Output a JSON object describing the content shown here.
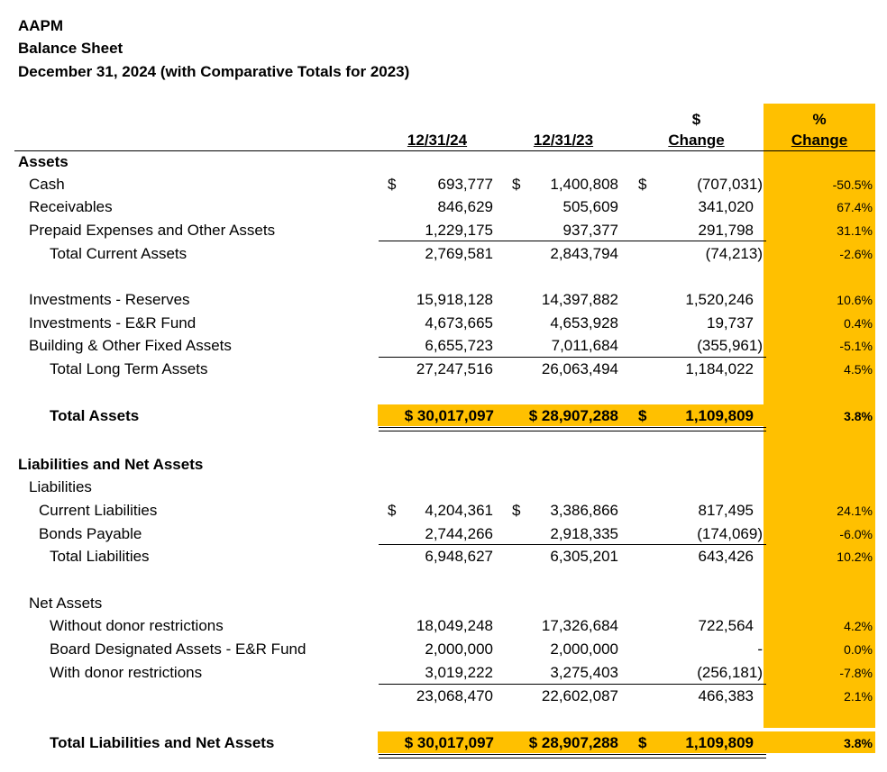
{
  "header": {
    "org": "AAPM",
    "title": "Balance Sheet",
    "period": "December 31, 2024 (with Comparative Totals for 2023)"
  },
  "columns": {
    "c2024": "12/31/24",
    "c2023": "12/31/23",
    "dollar_top": "$",
    "dollar_bottom": "Change",
    "pct_top": "%",
    "pct_bottom": "Change"
  },
  "highlight_color": "#FFC000",
  "rows": [
    {
      "label": "Assets",
      "bold": true
    },
    {
      "label": "Cash",
      "c2024": "693,777",
      "c2023": "1,400,808",
      "chg": "(707,031)",
      "pct": "-50.5%",
      "cur2024": "$",
      "cur2023": "$",
      "curChg": "$"
    },
    {
      "label": "Receivables",
      "c2024": "846,629",
      "c2023": "505,609",
      "chg": "341,020",
      "pct": "67.4%"
    },
    {
      "label": "Prepaid Expenses and Other Assets",
      "c2024": "1,229,175",
      "c2023": "937,377",
      "chg": "291,798",
      "pct": "31.1%"
    },
    {
      "label": "Total Current Assets",
      "c2024": "2,769,581",
      "c2023": "2,843,794",
      "chg": "(74,213)",
      "pct": "-2.6%"
    },
    {
      "label": "Investments - Reserves",
      "c2024": "15,918,128",
      "c2023": "14,397,882",
      "chg": "1,520,246",
      "pct": "10.6%"
    },
    {
      "label": "Investments - E&R Fund",
      "c2024": "4,673,665",
      "c2023": "4,653,928",
      "chg": "19,737",
      "pct": "0.4%"
    },
    {
      "label": "Building & Other Fixed Assets",
      "c2024": "6,655,723",
      "c2023": "7,011,684",
      "chg": "(355,961)",
      "pct": "-5.1%"
    },
    {
      "label": "Total Long Term Assets",
      "c2024": "27,247,516",
      "c2023": "26,063,494",
      "chg": "1,184,022",
      "pct": "4.5%"
    },
    {
      "label": "Total Assets",
      "bold": true,
      "c2024": "$ 30,017,097",
      "c2023": "$ 28,907,288",
      "chg": "1,109,809",
      "pct": "3.8%",
      "curChg": "$"
    },
    {
      "label": "Liabilities and Net Assets",
      "bold": true
    },
    {
      "label": "Liabilities"
    },
    {
      "label": "Current Liabilities",
      "c2024": "4,204,361",
      "c2023": "3,386,866",
      "chg": "817,495",
      "pct": "24.1%",
      "cur2024": "$",
      "cur2023": "$"
    },
    {
      "label": "Bonds Payable",
      "c2024": "2,744,266",
      "c2023": "2,918,335",
      "chg": "(174,069)",
      "pct": "-6.0%"
    },
    {
      "label": "Total Liabilities",
      "c2024": "6,948,627",
      "c2023": "6,305,201",
      "chg": "643,426",
      "pct": "10.2%"
    },
    {
      "label": "Net Assets"
    },
    {
      "label": "Without donor restrictions",
      "c2024": "18,049,248",
      "c2023": "17,326,684",
      "chg": "722,564",
      "pct": "4.2%"
    },
    {
      "label": "Board Designated Assets - E&R Fund",
      "c2024": "2,000,000",
      "c2023": "2,000,000",
      "chg": "-",
      "pct": "0.0%"
    },
    {
      "label": "With donor restrictions",
      "c2024": "3,019,222",
      "c2023": "3,275,403",
      "chg": "(256,181)",
      "pct": "-7.8%"
    },
    {
      "label": "",
      "c2024": "23,068,470",
      "c2023": "22,602,087",
      "chg": "466,383",
      "pct": "2.1%"
    },
    {
      "label": "Total Liabilities and Net Assets",
      "bold": true,
      "c2024": "$ 30,017,097",
      "c2023": "$ 28,907,288",
      "chg": "1,109,809",
      "pct": "3.8%",
      "curChg": "$"
    }
  ]
}
